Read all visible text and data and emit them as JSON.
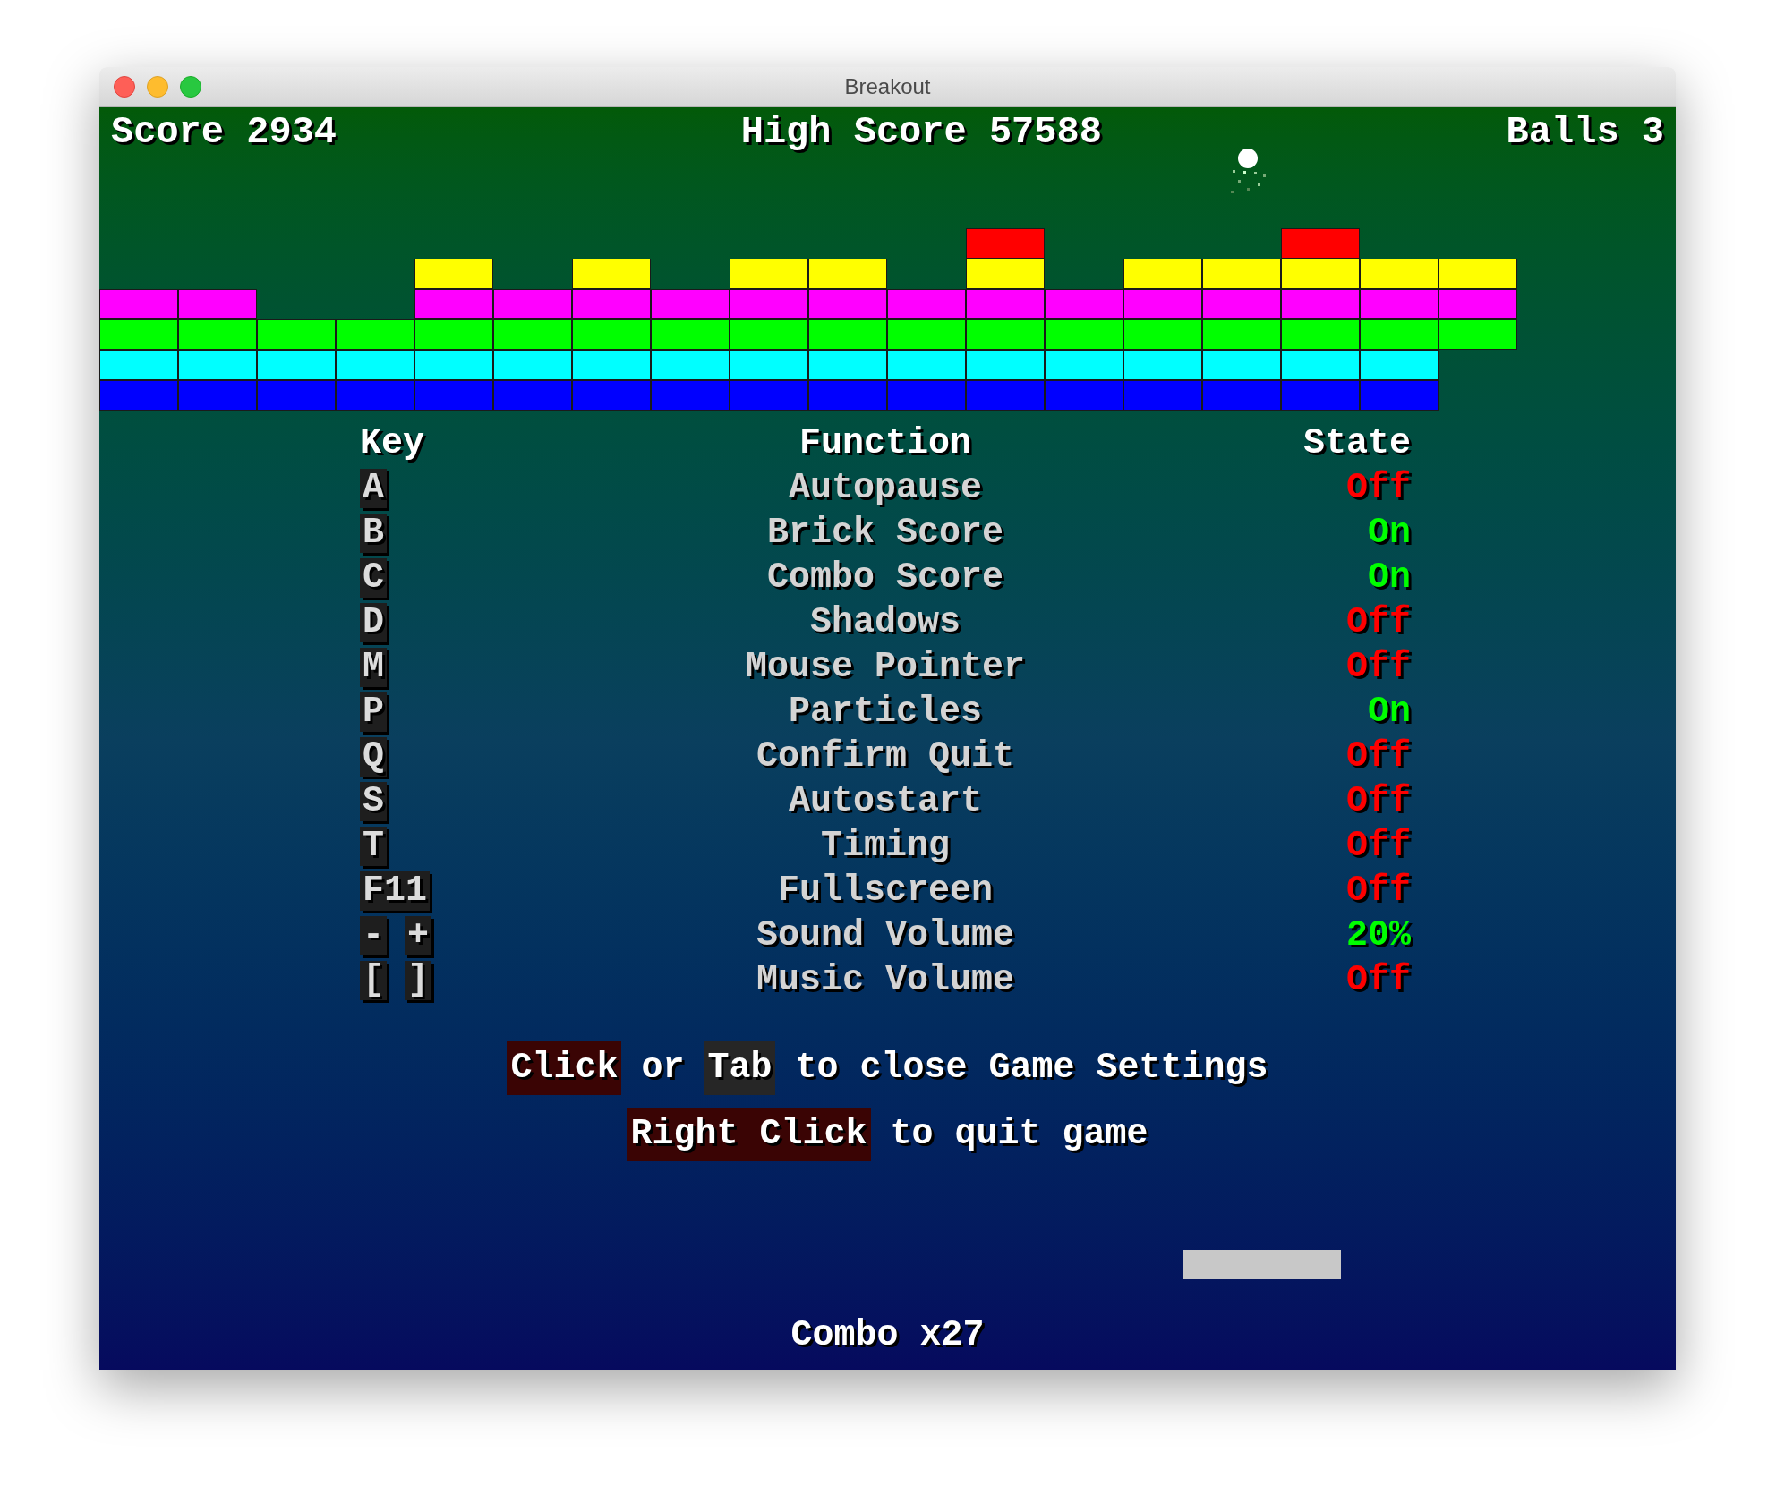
{
  "window": {
    "title": "Breakout"
  },
  "hud": {
    "score": "Score 2934",
    "high_score": "High Score 57588",
    "balls": "Balls 3"
  },
  "bricks": [
    {
      "color": "#ff0000",
      "cells": [
        {
          "kind": "gap"
        },
        {
          "kind": "gap"
        },
        {
          "kind": "gap"
        },
        {
          "kind": "gap"
        },
        {
          "kind": "gap"
        },
        {
          "kind": "gap"
        },
        {
          "kind": "gap"
        },
        {
          "kind": "gap"
        },
        {
          "kind": "gap"
        },
        {
          "kind": "gap"
        },
        {
          "kind": "gap"
        },
        {
          "kind": "brick"
        },
        {
          "kind": "gap"
        },
        {
          "kind": "gap"
        },
        {
          "kind": "gap"
        },
        {
          "kind": "brick"
        }
      ]
    },
    {
      "color": "#ffff00",
      "cells": [
        {
          "kind": "gap"
        },
        {
          "kind": "gap"
        },
        {
          "kind": "gap"
        },
        {
          "kind": "gap"
        },
        {
          "kind": "brick"
        },
        {
          "kind": "gap"
        },
        {
          "kind": "brick"
        },
        {
          "kind": "gap"
        },
        {
          "kind": "brick"
        },
        {
          "kind": "brick"
        },
        {
          "kind": "gap"
        },
        {
          "kind": "brick"
        },
        {
          "kind": "gap"
        },
        {
          "kind": "brick"
        },
        {
          "kind": "brick"
        },
        {
          "kind": "brick"
        },
        {
          "kind": "brick"
        },
        {
          "kind": "brick"
        }
      ]
    },
    {
      "color": "#ff00ff",
      "cells": [
        {
          "kind": "brick"
        },
        {
          "kind": "brick"
        },
        {
          "kind": "gap"
        },
        {
          "kind": "gap"
        },
        {
          "kind": "brick"
        },
        {
          "kind": "brick"
        },
        {
          "kind": "brick"
        },
        {
          "kind": "brick"
        },
        {
          "kind": "brick"
        },
        {
          "kind": "brick"
        },
        {
          "kind": "brick"
        },
        {
          "kind": "brick"
        },
        {
          "kind": "brick"
        },
        {
          "kind": "brick"
        },
        {
          "kind": "brick"
        },
        {
          "kind": "brick"
        },
        {
          "kind": "brick"
        },
        {
          "kind": "brick"
        }
      ]
    },
    {
      "color": "#00ff00",
      "cells": [
        {
          "kind": "brick"
        },
        {
          "kind": "brick"
        },
        {
          "kind": "brick"
        },
        {
          "kind": "brick"
        },
        {
          "kind": "brick"
        },
        {
          "kind": "brick"
        },
        {
          "kind": "brick"
        },
        {
          "kind": "brick"
        },
        {
          "kind": "brick"
        },
        {
          "kind": "brick"
        },
        {
          "kind": "brick"
        },
        {
          "kind": "brick"
        },
        {
          "kind": "brick"
        },
        {
          "kind": "brick"
        },
        {
          "kind": "brick"
        },
        {
          "kind": "brick"
        },
        {
          "kind": "brick"
        },
        {
          "kind": "brick"
        }
      ]
    },
    {
      "color": "#00ffff",
      "cells": [
        {
          "kind": "brick"
        },
        {
          "kind": "brick"
        },
        {
          "kind": "brick"
        },
        {
          "kind": "brick"
        },
        {
          "kind": "brick"
        },
        {
          "kind": "brick"
        },
        {
          "kind": "brick"
        },
        {
          "kind": "brick"
        },
        {
          "kind": "brick"
        },
        {
          "kind": "brick"
        },
        {
          "kind": "brick"
        },
        {
          "kind": "brick"
        },
        {
          "kind": "brick"
        },
        {
          "kind": "brick"
        },
        {
          "kind": "brick"
        },
        {
          "kind": "brick"
        },
        {
          "kind": "brick"
        }
      ]
    },
    {
      "color": "#0000ff",
      "cells": [
        {
          "kind": "brick"
        },
        {
          "kind": "brick"
        },
        {
          "kind": "brick"
        },
        {
          "kind": "brick"
        },
        {
          "kind": "brick"
        },
        {
          "kind": "brick"
        },
        {
          "kind": "brick"
        },
        {
          "kind": "brick"
        },
        {
          "kind": "brick"
        },
        {
          "kind": "brick"
        },
        {
          "kind": "brick"
        },
        {
          "kind": "brick"
        },
        {
          "kind": "brick"
        },
        {
          "kind": "brick"
        },
        {
          "kind": "brick"
        },
        {
          "kind": "brick"
        },
        {
          "kind": "brick"
        }
      ]
    }
  ],
  "settings": {
    "columns": [
      "Key",
      "Function",
      "State"
    ],
    "rows": [
      {
        "keys": [
          "A"
        ],
        "function": "Autopause",
        "state": "Off",
        "on": false
      },
      {
        "keys": [
          "B"
        ],
        "function": "Brick Score",
        "state": "On",
        "on": true
      },
      {
        "keys": [
          "C"
        ],
        "function": "Combo Score",
        "state": "On",
        "on": true
      },
      {
        "keys": [
          "D"
        ],
        "function": "Shadows",
        "state": "Off",
        "on": false
      },
      {
        "keys": [
          "M"
        ],
        "function": "Mouse Pointer",
        "state": "Off",
        "on": false
      },
      {
        "keys": [
          "P"
        ],
        "function": "Particles",
        "state": "On",
        "on": true
      },
      {
        "keys": [
          "Q"
        ],
        "function": "Confirm Quit",
        "state": "Off",
        "on": false
      },
      {
        "keys": [
          "S"
        ],
        "function": "Autostart",
        "state": "Off",
        "on": false
      },
      {
        "keys": [
          "T"
        ],
        "function": "Timing",
        "state": "Off",
        "on": false
      },
      {
        "keys": [
          "F11"
        ],
        "function": "Fullscreen",
        "state": "Off",
        "on": false
      },
      {
        "keys": [
          "-",
          "+"
        ],
        "function": "Sound Volume",
        "state": "20%",
        "on": true
      },
      {
        "keys": [
          "[",
          "]"
        ],
        "function": "Music Volume",
        "state": "Off",
        "on": false
      }
    ]
  },
  "hints": [
    [
      {
        "kind": "mouse",
        "text": "Click"
      },
      {
        "kind": "text",
        "text": "or"
      },
      {
        "kind": "key",
        "text": "Tab"
      },
      {
        "kind": "text",
        "text": "to close Game Settings"
      }
    ],
    [
      {
        "kind": "mouse",
        "text": "Right Click"
      },
      {
        "kind": "text",
        "text": "to quit game"
      }
    ]
  ],
  "combo": "Combo x27"
}
